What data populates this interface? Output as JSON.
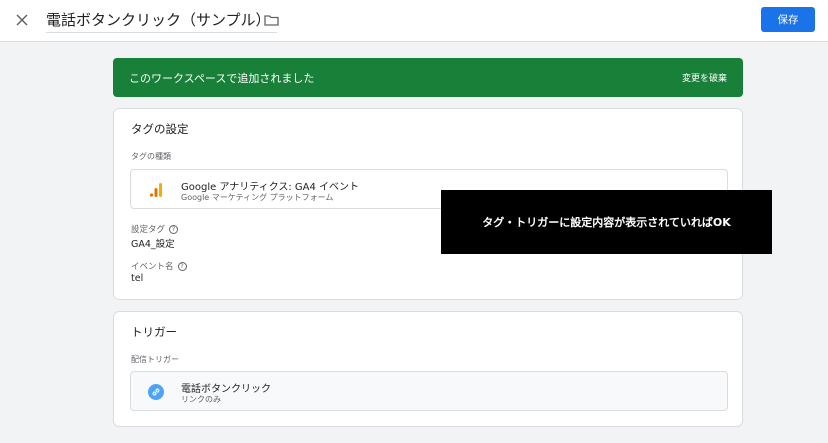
{
  "header": {
    "title": "電話ボタンクリック（サンプル）",
    "save_label": "保存"
  },
  "banner": {
    "message": "このワークスペースで追加されました",
    "discard_label": "変更を破棄",
    "color": "#188038"
  },
  "tag_card": {
    "title": "タグの設定",
    "type_label": "タグの種類",
    "tag_type": {
      "name": "Google アナリティクス: GA4 イベント",
      "platform": "Google マーケティング プラットフォーム",
      "icon": "google-analytics-icon"
    },
    "config_tag_label": "設定タグ",
    "config_tag_value": "GA4_設定",
    "event_name_label": "イベント名",
    "event_name_value": "tel"
  },
  "trigger_card": {
    "title": "トリガー",
    "firing_label": "配信トリガー",
    "trigger": {
      "name": "電話ボタンクリック",
      "type": "リンクのみ",
      "icon": "link-icon"
    }
  },
  "overlay": {
    "text": "タグ・トリガーに設定内容が表示されていればOK"
  },
  "colors": {
    "primary": "#1a73e8",
    "success": "#188038",
    "ga_orange": "#f9ab00",
    "link_blue": "#4fa3f7"
  }
}
